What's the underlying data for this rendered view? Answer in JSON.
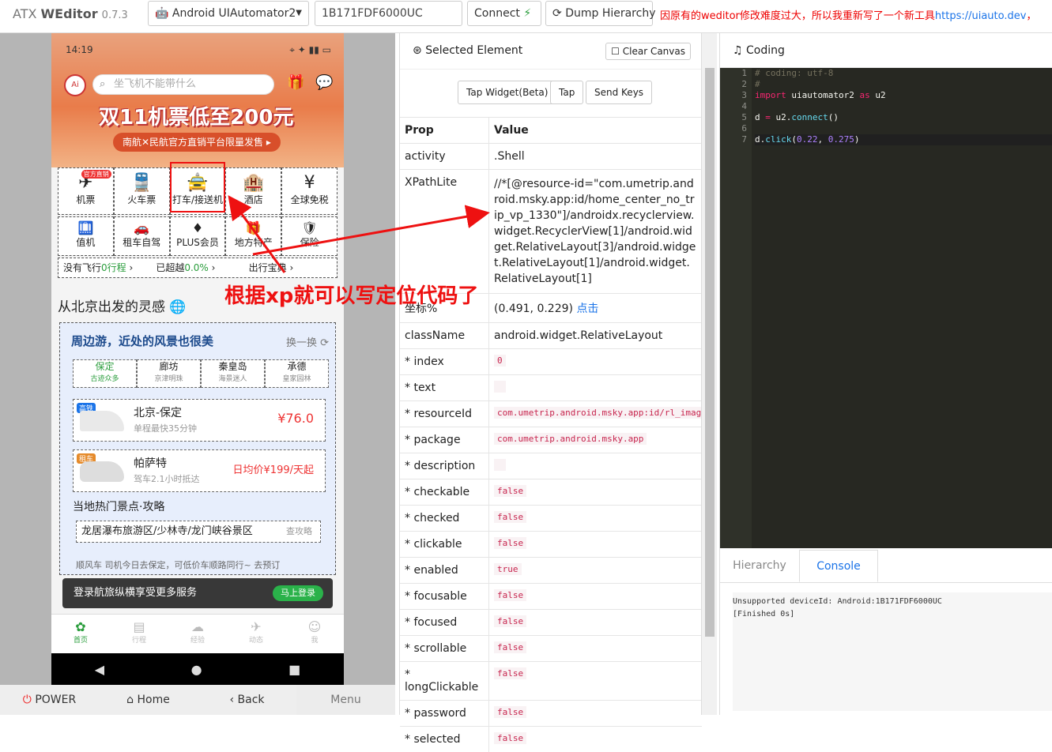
{
  "header": {
    "brand_prefix": "ATX ",
    "brand_bold": "WEditor",
    "version": "0.7.3",
    "platform": "Android UIAutomator2",
    "serial": "1B171FDF6000UC",
    "connect_label": "Connect",
    "dump_label": "Dump Hierarchy",
    "notice": "因原有的weditor修改难度过大，所以我重新写了一个新工具",
    "notice_link": "https://uiauto.dev",
    "notice_tail": "，"
  },
  "phone": {
    "time": "14:19",
    "search_placeholder": "坐飞机不能带什么",
    "ai_label": "Ai",
    "banner_title": "双11机票低至200元",
    "banner_sub": "南航✕民航官方直销平台限量发售 ▸",
    "grid1": [
      {
        "label": "机票",
        "icon": "plane-icon",
        "glyph": "✈",
        "badge": "官方直销"
      },
      {
        "label": "火车票",
        "icon": "train-icon",
        "glyph": "🚆"
      },
      {
        "label": "打车/接送机",
        "icon": "car-icon",
        "glyph": "🚖"
      },
      {
        "label": "酒店",
        "icon": "hotel-icon",
        "glyph": "🏨"
      },
      {
        "label": "全球免税",
        "icon": "dutyfree-icon",
        "glyph": "¥"
      }
    ],
    "grid2": [
      {
        "label": "值机",
        "icon": "checkin-icon",
        "glyph": "🛄"
      },
      {
        "label": "租车自驾",
        "icon": "rental-icon",
        "glyph": "🚗"
      },
      {
        "label": "PLUS会员",
        "icon": "plus-icon",
        "glyph": "♦"
      },
      {
        "label": "地方特产",
        "icon": "specialty-icon",
        "glyph": "🎁"
      },
      {
        "label": "保险",
        "icon": "insurance-icon",
        "glyph": "🛡"
      }
    ],
    "info": {
      "a": "没有飞行",
      "a2": "0行程",
      "b": "已超越",
      "b2": "0.0%",
      "c": "出行宝典"
    },
    "section_title": "从北京出发的灵感",
    "card_title": "周边游，近处的风景也很美",
    "swap_label": "换一换",
    "tabs": [
      {
        "name": "保定",
        "sub": "古迹众多"
      },
      {
        "name": "廊坊",
        "sub": "京津明珠"
      },
      {
        "name": "秦皇岛",
        "sub": "海景迷人"
      },
      {
        "name": "承德",
        "sub": "皇家园林"
      }
    ],
    "routes": [
      {
        "tag": "高铁",
        "name": "北京-保定",
        "desc": "单程最快35分钟",
        "price": "¥76.0"
      },
      {
        "tag": "租车",
        "name": "帕萨特",
        "desc": "驾车2.1小时抵达",
        "price": "日均价¥199/天起"
      }
    ],
    "spots_title": "当地热门景点·攻略",
    "spot_line": "龙居瀑布旅游区/少林寺/龙门峡谷景区",
    "spot_more": "查攻略",
    "shunfeng": "顺风车  司机今日去保定，可低价车顺路同行~   去预订",
    "login_text": "登录航旅纵横享受更多服务",
    "login_btn": "马上登录",
    "tabbar": [
      {
        "label": "首页",
        "icon": "home-icon",
        "glyph": "✿"
      },
      {
        "label": "行程",
        "icon": "trip-icon",
        "glyph": "▤"
      },
      {
        "label": "经验",
        "icon": "explore-icon",
        "glyph": "☁"
      },
      {
        "label": "动态",
        "icon": "feed-icon",
        "glyph": "✈"
      },
      {
        "label": "我",
        "icon": "profile-icon",
        "glyph": "☺"
      }
    ]
  },
  "device_buttons": {
    "power": "POWER",
    "home": "Home",
    "back": "Back",
    "menu": "Menu"
  },
  "annotation": "根据xp就可以写定位代码了",
  "inspector": {
    "title": "Selected Element",
    "clear_label": "Clear Canvas",
    "actions": [
      "Tap Widget(Beta)",
      "Tap",
      "Send Keys"
    ],
    "col_prop": "Prop",
    "col_value": "Value",
    "activity": ".Shell",
    "xpath": "//*[@resource-id=\"com.umetrip.android.msky.app:id/home_center_no_trip_vp_1330\"]/androidx.recyclerview.widget.RecyclerView[1]/android.widget.RelativeLayout[3]/android.widget.RelativeLayout[1]/android.widget.RelativeLayout[1]",
    "coord_label": "坐标%",
    "coord_value": "(0.491, 0.229)",
    "coord_link": "点击",
    "className": "android.widget.RelativeLayout",
    "props": [
      {
        "k": "* index",
        "v": "0"
      },
      {
        "k": "* text",
        "v": ""
      },
      {
        "k": "* resourceId",
        "v": "com.umetrip.android.msky.app:id/rl_image"
      },
      {
        "k": "* package",
        "v": "com.umetrip.android.msky.app"
      },
      {
        "k": "* description",
        "v": ""
      },
      {
        "k": "* checkable",
        "v": "false"
      },
      {
        "k": "* checked",
        "v": "false"
      },
      {
        "k": "* clickable",
        "v": "false"
      },
      {
        "k": "* enabled",
        "v": "true"
      },
      {
        "k": "* focusable",
        "v": "false"
      },
      {
        "k": "* focused",
        "v": "false"
      },
      {
        "k": "* scrollable",
        "v": "false"
      },
      {
        "k": "* longClickable",
        "v": "false"
      },
      {
        "k": "* password",
        "v": "false"
      },
      {
        "k": "* selected",
        "v": "false"
      }
    ]
  },
  "coding": {
    "title": "Coding",
    "tab_hierarchy": "Hierarchy",
    "tab_console": "Console",
    "console_lines": [
      "Unsupported deviceId: Android:1B171FDF6000UC",
      "[Finished 0s]"
    ]
  }
}
